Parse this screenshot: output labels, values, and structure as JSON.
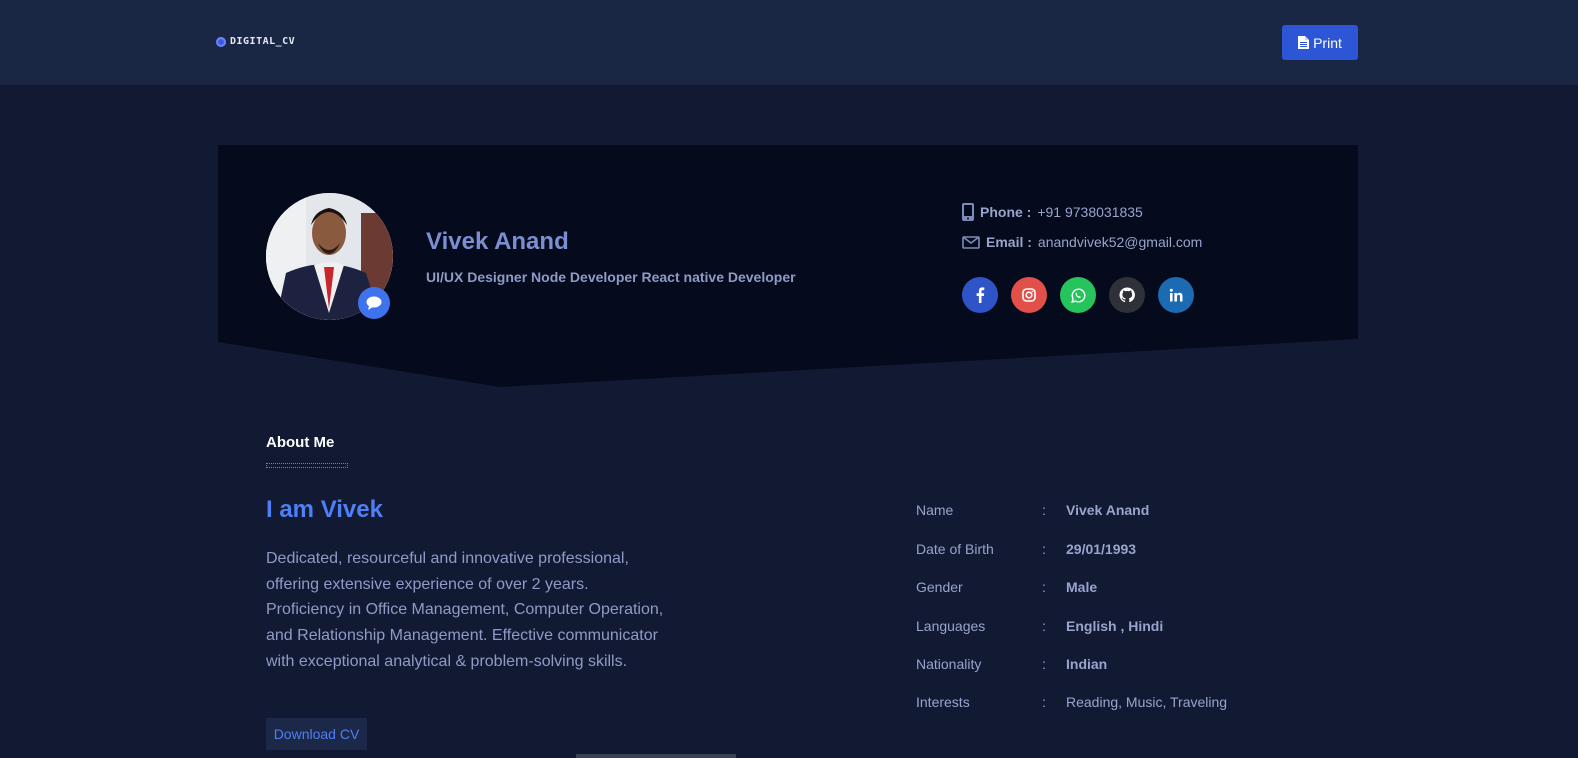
{
  "navbar": {
    "brand": "DIGITAL_CV",
    "print_label": "Print"
  },
  "profile": {
    "name": "Vivek Anand",
    "title": "UI/UX Designer Node Developer React native Developer",
    "phone_label": "Phone :",
    "phone": "+91 9738031835",
    "email_label": "Email :",
    "email": "anandvivek52@gmail.com"
  },
  "socials": [
    {
      "name": "facebook",
      "color": "#2f54c8"
    },
    {
      "name": "instagram",
      "color": "#e2504a"
    },
    {
      "name": "whatsapp",
      "color": "#27c45d"
    },
    {
      "name": "github",
      "color": "#2f3138"
    },
    {
      "name": "linkedin",
      "color": "#1c6ab1"
    }
  ],
  "about": {
    "heading": "About Me",
    "intro": "I am Vivek",
    "description": "Dedicated, resourceful and innovative professional, offering extensive experience of over 2 years. Proficiency in Office Management, Computer Operation, and Relationship Management. Effective communicator with exceptional analytical & problem-solving skills.",
    "download_label": "Download CV"
  },
  "info": [
    {
      "label": "Name",
      "sep": ":",
      "value": "Vivek Anand"
    },
    {
      "label": "Date of Birth",
      "sep": ":",
      "value": "29/01/1993"
    },
    {
      "label": "Gender",
      "sep": ":",
      "value": "Male"
    },
    {
      "label": "Languages",
      "sep": ":",
      "value": "English , Hindi"
    },
    {
      "label": "Nationality",
      "sep": ":",
      "value": "Indian"
    },
    {
      "label": "Interests",
      "sep": ":",
      "value": "Reading, Music, Traveling"
    }
  ],
  "colors": {
    "background": "#121a33",
    "navbar": "#1a2744",
    "header_card": "#050a1c",
    "accent": "#4f7ef5",
    "button": "#2d56d6"
  }
}
